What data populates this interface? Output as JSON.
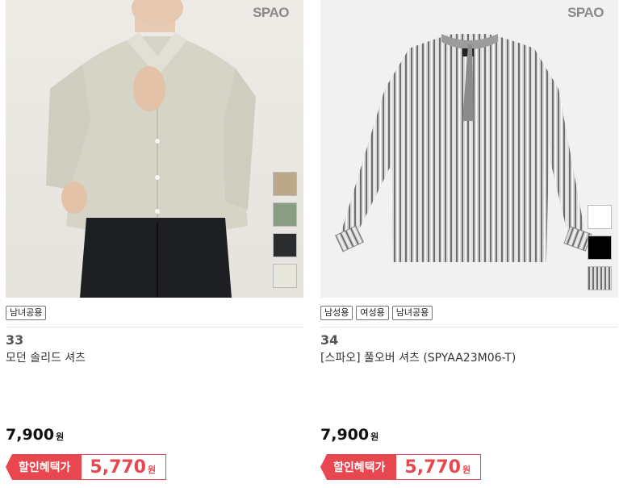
{
  "products": [
    {
      "rank": "33",
      "name": "모던 솔리드 셔츠",
      "brand_logo": "SPAO",
      "tags": [
        "남녀공용"
      ],
      "price": "7,900",
      "currency": "원",
      "benefit_label": "할인혜택가",
      "benefit_price": "5,770",
      "swatches": [
        "#bba888",
        "#8a9c84",
        "#2b2c2e",
        "#e6e6dd"
      ]
    },
    {
      "rank": "34",
      "name": "[스파오] 풀오버 셔츠 (SPYAA23M06-T)",
      "brand_logo": "SPAO",
      "tags": [
        "남성용",
        "여성용",
        "남녀공용"
      ],
      "price": "7,900",
      "currency": "원",
      "benefit_label": "할인혜택가",
      "benefit_price": "5,770",
      "swatches": [
        "#ffffff",
        "#000000",
        "stripe"
      ]
    }
  ]
}
